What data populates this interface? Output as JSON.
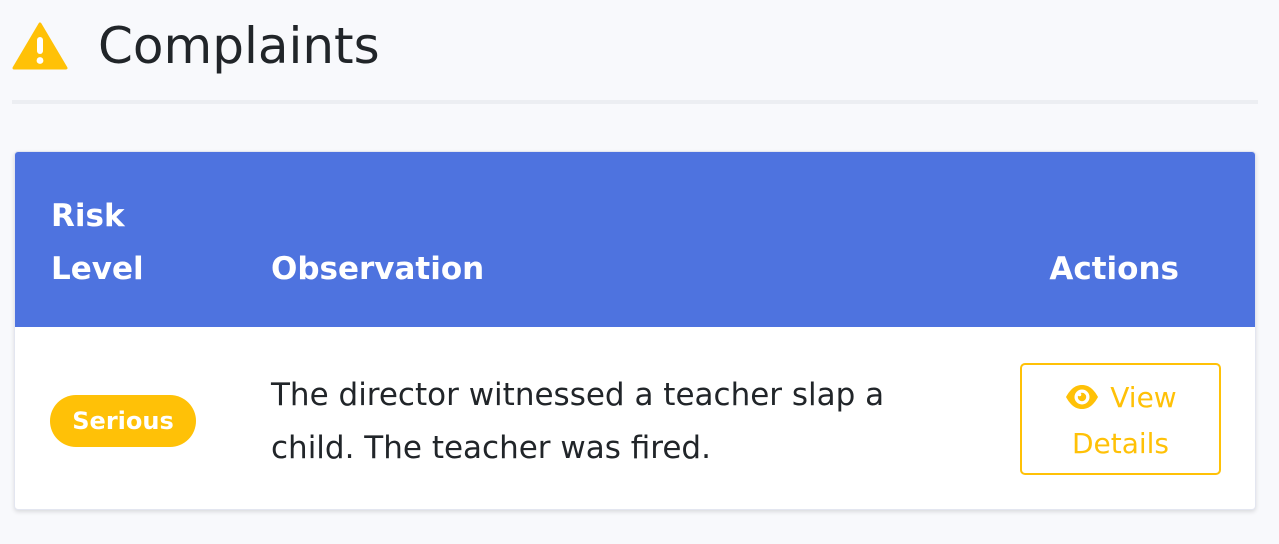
{
  "header": {
    "title": "Complaints",
    "icon": "warning-triangle-icon"
  },
  "table": {
    "columns": {
      "risk_level": "Risk Level",
      "observation": "Observation",
      "actions": "Actions"
    },
    "rows": [
      {
        "risk_level": "Serious",
        "observation": "The director witnessed a teacher slap a child. The teacher was fired.",
        "action": {
          "icon": "eye-icon",
          "label_line1": "View",
          "label_line2": "Details"
        }
      }
    ]
  },
  "colors": {
    "header_bg": "#4e73df",
    "warning": "#ffc107",
    "page_bg": "#f8f9fc"
  }
}
